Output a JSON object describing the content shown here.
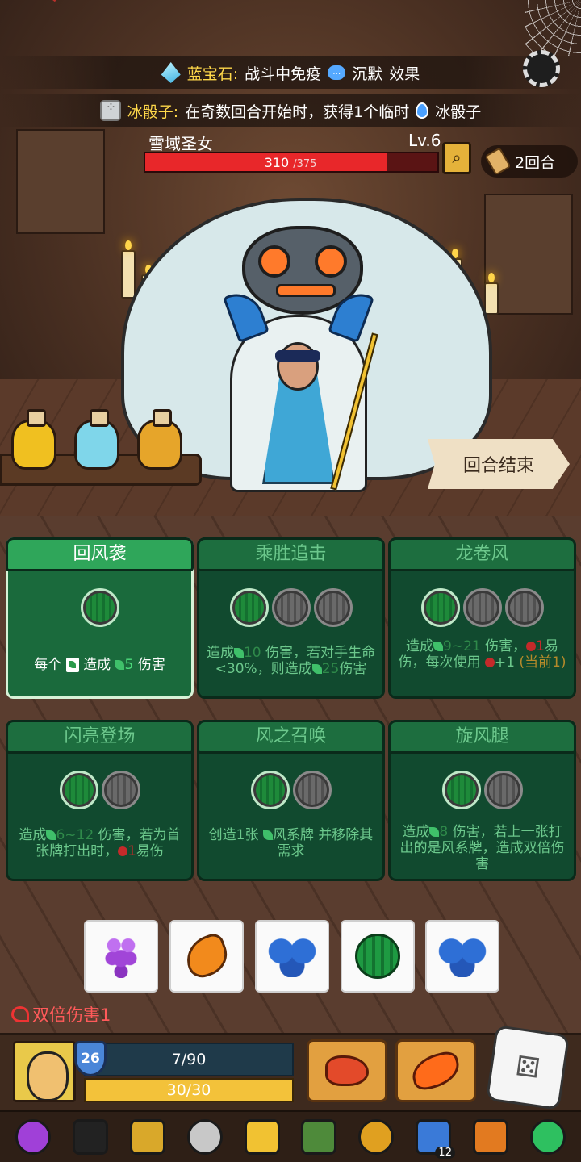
{
  "effects": {
    "sapphire": {
      "name": "蓝宝石:",
      "text": "战斗中免疫",
      "keyword": "沉默",
      "suffix": "效果"
    },
    "ice_dice": {
      "name": "冰骰子:",
      "text": "在奇数回合开始时，获得1个临时",
      "suffix": "冰骰子"
    }
  },
  "enemy": {
    "name": "雪域圣女",
    "level": "Lv.6",
    "hp_current": "310",
    "hp_max": "/375",
    "hp_fraction": 0.827
  },
  "turn_badge": {
    "label": "2回合"
  },
  "end_turn_button": {
    "label": "回合结束"
  },
  "skills": [
    {
      "title": "回风袭",
      "slots": [
        "green"
      ],
      "desc_parts": [
        "每个",
        "造成",
        "5",
        "伤害"
      ]
    },
    {
      "title": "乘胜追击",
      "slots": [
        "green",
        "gray",
        "gray"
      ],
      "desc_parts": [
        "造成",
        "10",
        "伤害，若对手生命<30%，则造成",
        "25",
        "伤害"
      ]
    },
    {
      "title": "龙卷风",
      "slots": [
        "green",
        "gray",
        "gray"
      ],
      "desc_parts": [
        "造成",
        "9~21",
        "伤害，",
        "1",
        "易伤，每次使用",
        "+1",
        "(当前1)"
      ]
    },
    {
      "title": "闪亮登场",
      "slots": [
        "green",
        "gray"
      ],
      "desc_parts": [
        "造成",
        "6~12",
        "伤害，若为首张牌打出时，",
        "1",
        "易伤"
      ]
    },
    {
      "title": "风之召唤",
      "slots": [
        "green",
        "gray"
      ],
      "desc_parts": [
        "创造1张",
        "风系牌",
        "并移除其需求"
      ]
    },
    {
      "title": "旋风腿",
      "slots": [
        "green",
        "gray"
      ],
      "desc_parts": [
        "造成",
        "8",
        "伤害，若上一张打出的是风系牌，造成双倍伤害"
      ]
    }
  ],
  "dice": [
    {
      "face": "grape-icon"
    },
    {
      "face": "orange-fruit-icon"
    },
    {
      "face": "blueberry-icon"
    },
    {
      "face": "melon-icon"
    },
    {
      "face": "blueberry-icon"
    }
  ],
  "buff": {
    "label": "双倍伤害1"
  },
  "player": {
    "shield_value": "26",
    "hp_text": "7/90",
    "energy_text": "30/30",
    "energy_fraction": 1.0
  },
  "relics": [
    {
      "icon": "purple-potion-icon",
      "color": "#a040d8"
    },
    {
      "icon": "black-armor-icon",
      "color": "#222222"
    },
    {
      "icon": "gold-egg-icon",
      "color": "#d9a82a"
    },
    {
      "icon": "scroll-icon",
      "color": "#c8c8c8"
    },
    {
      "icon": "crown-icon",
      "color": "#f1c232"
    },
    {
      "icon": "green-card-icon",
      "color": "#4e8a3a"
    },
    {
      "icon": "gold-coin-icon",
      "color": "#e0a020"
    },
    {
      "icon": "blue-shield-icon",
      "color": "#3a7ad8",
      "count": "12"
    },
    {
      "icon": "orange-cloth-icon",
      "color": "#e27a20"
    },
    {
      "icon": "green-leaf-icon",
      "color": "#2ec060"
    }
  ]
}
